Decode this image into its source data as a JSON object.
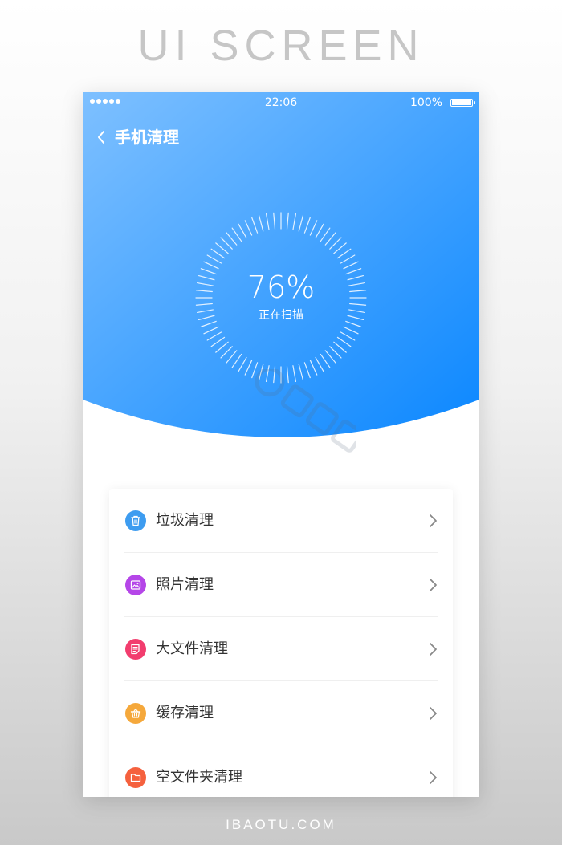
{
  "frame": {
    "title": "UI SCREEN",
    "footer": "IBAOTU.COM"
  },
  "status_bar": {
    "time": "22:06",
    "battery": "100%"
  },
  "nav": {
    "title": "手机清理"
  },
  "scan": {
    "percent": 76,
    "percent_text": "76%",
    "caption": "正在扫描"
  },
  "menu": [
    {
      "label": "垃圾清理",
      "icon": "trash-icon",
      "color": "#3d9cf0"
    },
    {
      "label": "照片清理",
      "icon": "photo-icon",
      "color": "#b546e8"
    },
    {
      "label": "大文件清理",
      "icon": "document-icon",
      "color": "#f23d6e"
    },
    {
      "label": "缓存清理",
      "icon": "basket-icon",
      "color": "#f5a83b"
    },
    {
      "label": "空文件夹清理",
      "icon": "folder-icon",
      "color": "#f5613e"
    }
  ],
  "colors": {
    "header_gradient_start": "#7ec0ff",
    "header_gradient_end": "#0b87ff",
    "text_primary": "#333333",
    "chevron": "#888888"
  }
}
